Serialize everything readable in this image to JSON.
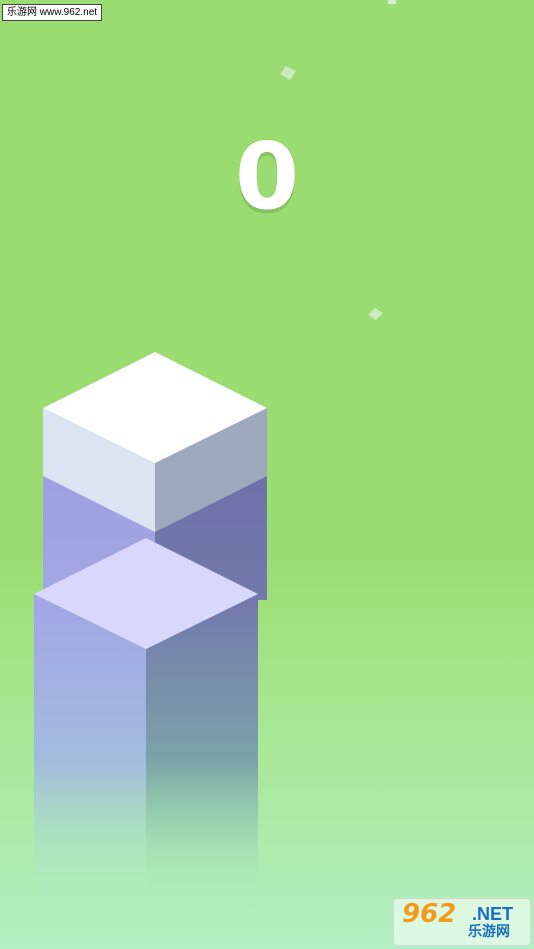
{
  "watermark": {
    "text": "乐游网 www.962.net"
  },
  "hud": {
    "score": "0"
  },
  "logo": {
    "digits": "962",
    "net": ".NET",
    "cn": "乐游网"
  },
  "colors": {
    "background_top": "#9adc72",
    "background_bottom": "#b1f0c2",
    "top_block": "#ffffff",
    "tower_block": "#d8d8fb"
  }
}
